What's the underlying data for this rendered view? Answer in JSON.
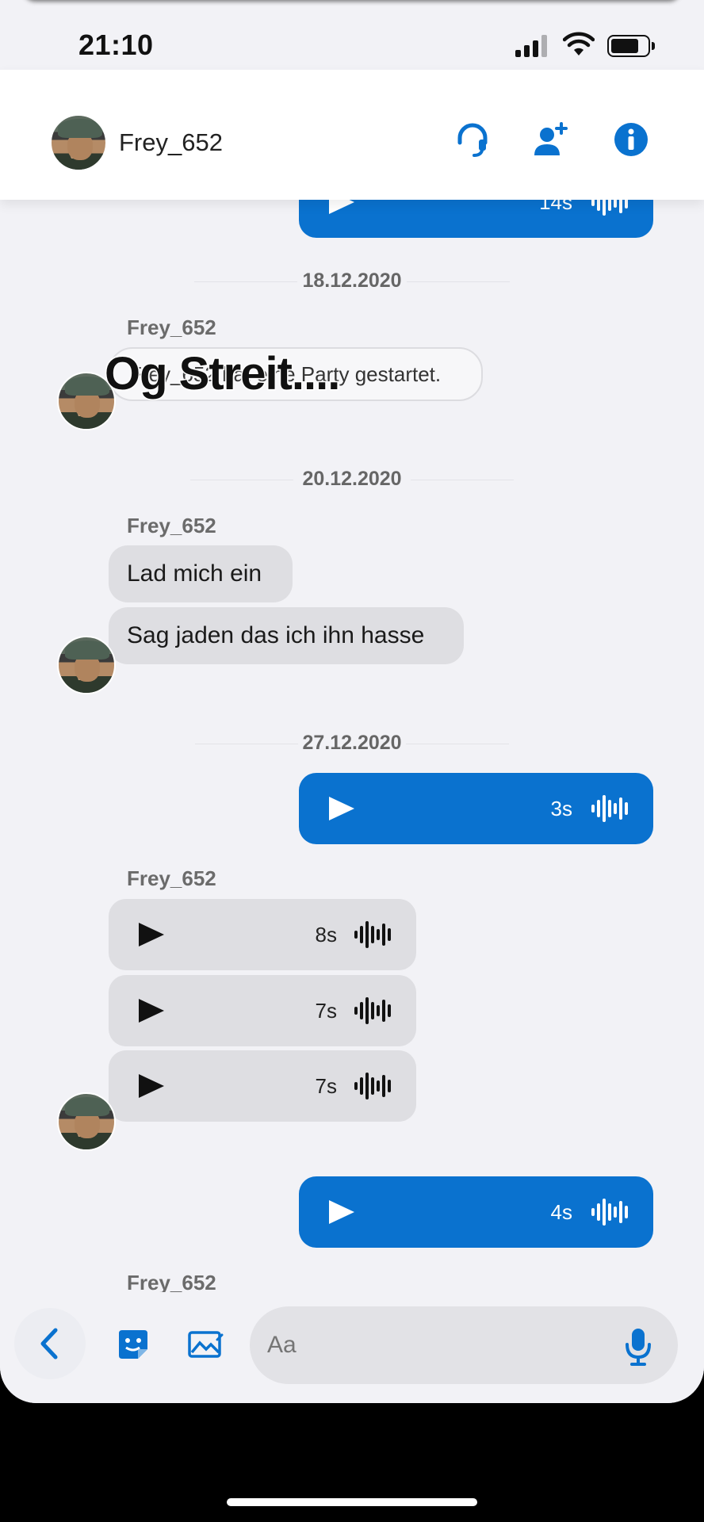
{
  "status_bar": {
    "time": "21:10"
  },
  "header": {
    "contact_name": "Frey_652"
  },
  "caption": "Og Streit....",
  "chat": {
    "top_partial_duration": "14s",
    "groups": [
      {
        "date": "18.12.2020",
        "sender": "Frey_652",
        "system_text": "Frey_652 hat eine Party gestartet."
      },
      {
        "date": "20.12.2020",
        "sender": "Frey_652",
        "messages": [
          "Lad mich ein",
          "Sag jaden das ich ihn hasse"
        ]
      },
      {
        "date": "27.12.2020"
      }
    ],
    "voice_out_1": "3s",
    "voice_in_sender": "Frey_652",
    "voice_in": [
      "8s",
      "7s",
      "7s"
    ],
    "voice_out_2": "4s",
    "partial_sender": "Frey_652"
  },
  "composer": {
    "placeholder": "Aa"
  },
  "colors": {
    "accent": "#0a72cf",
    "incoming_bubble": "#dedee2",
    "background": "#f2f2f6"
  }
}
